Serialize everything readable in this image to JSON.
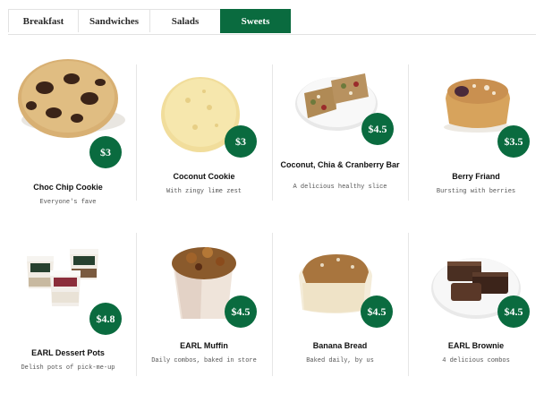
{
  "tabs": [
    {
      "label": "Breakfast",
      "active": false
    },
    {
      "label": "Sandwiches",
      "active": false
    },
    {
      "label": "Salads",
      "active": false
    },
    {
      "label": "Sweets",
      "active": true
    }
  ],
  "colors": {
    "accent": "#0a6b3f",
    "divider": "#e6e6e6"
  },
  "products": [
    {
      "name": "Choc Chip Cookie",
      "description": "Everyone's fave",
      "price": "$3",
      "icon": "cookie-choc-chip-image"
    },
    {
      "name": "Coconut Cookie",
      "description": "With zingy lime zest",
      "price": "$3",
      "icon": "cookie-coconut-image"
    },
    {
      "name": "Coconut, Chia & Cranberry Bar",
      "description": "A delicious healthy slice",
      "price": "$4.5",
      "icon": "bar-slice-image"
    },
    {
      "name": "Berry Friand",
      "description": "Bursting with berries",
      "price": "$3.5",
      "icon": "friand-image"
    },
    {
      "name": "EARL Dessert Pots",
      "description": "Delish pots of pick-me-up",
      "price": "$4.8",
      "icon": "dessert-pots-image"
    },
    {
      "name": "EARL Muffin",
      "description": "Daily combos, baked in store",
      "price": "$4.5",
      "icon": "muffin-image"
    },
    {
      "name": "Banana Bread",
      "description": "Baked daily, by us",
      "price": "$4.5",
      "icon": "banana-bread-image"
    },
    {
      "name": "EARL Brownie",
      "description": "4 delicious combos",
      "price": "$4.5",
      "icon": "brownie-image"
    }
  ]
}
